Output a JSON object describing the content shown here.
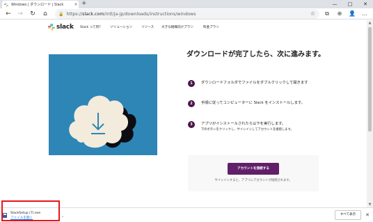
{
  "browser": {
    "tab_title": "Windows | ダウンロード | Slack",
    "tab_close": "×",
    "new_tab": "+",
    "window_controls": [
      "—",
      "□",
      "✕"
    ],
    "nav": {
      "back": "←",
      "forward": "→",
      "reload": "↻",
      "home": "⌂"
    },
    "url_prefix": "https://",
    "url_host": "slack.com",
    "url_path": "/intl/ja-jp/downloads/instructions/windows",
    "toolbar_icons": [
      "☆",
      "⧉",
      "⊕",
      "👤",
      "…"
    ]
  },
  "site": {
    "logo_text": "slack",
    "nav_links": [
      "Slack って何？",
      "ソリューション",
      "リソース",
      "大きな組織向けプラン",
      "料金プラン"
    ]
  },
  "main": {
    "heading": "ダウンロードが完了したら、次に進みます。",
    "steps": [
      {
        "num": "1",
        "text": "ダウンロードフォルダでファイルをダブルクリックして開きます",
        "sub": ""
      },
      {
        "num": "2",
        "text": "手順に従ってコンピューターに Slack をインストールします。",
        "sub": ""
      },
      {
        "num": "3",
        "text": "アプリがインストールされたら以下を実行します。",
        "sub": "下のボタンをクリックし、サインインしてアカウントを接続します。"
      }
    ],
    "signin_button": "アカウントを接続する",
    "signin_note": "サインインすると、アプリにアカウントが接続されます。"
  },
  "downloads": {
    "file_name": "SlackSetup (7).exe",
    "open_link": "ファイルを開く",
    "show_all": "すべて表示",
    "close": "✕"
  },
  "colors": {
    "hero_bg": "#2d86b5",
    "aubergine": "#611f69",
    "step_badge": "#4a154b",
    "highlight": "#e8141b"
  }
}
